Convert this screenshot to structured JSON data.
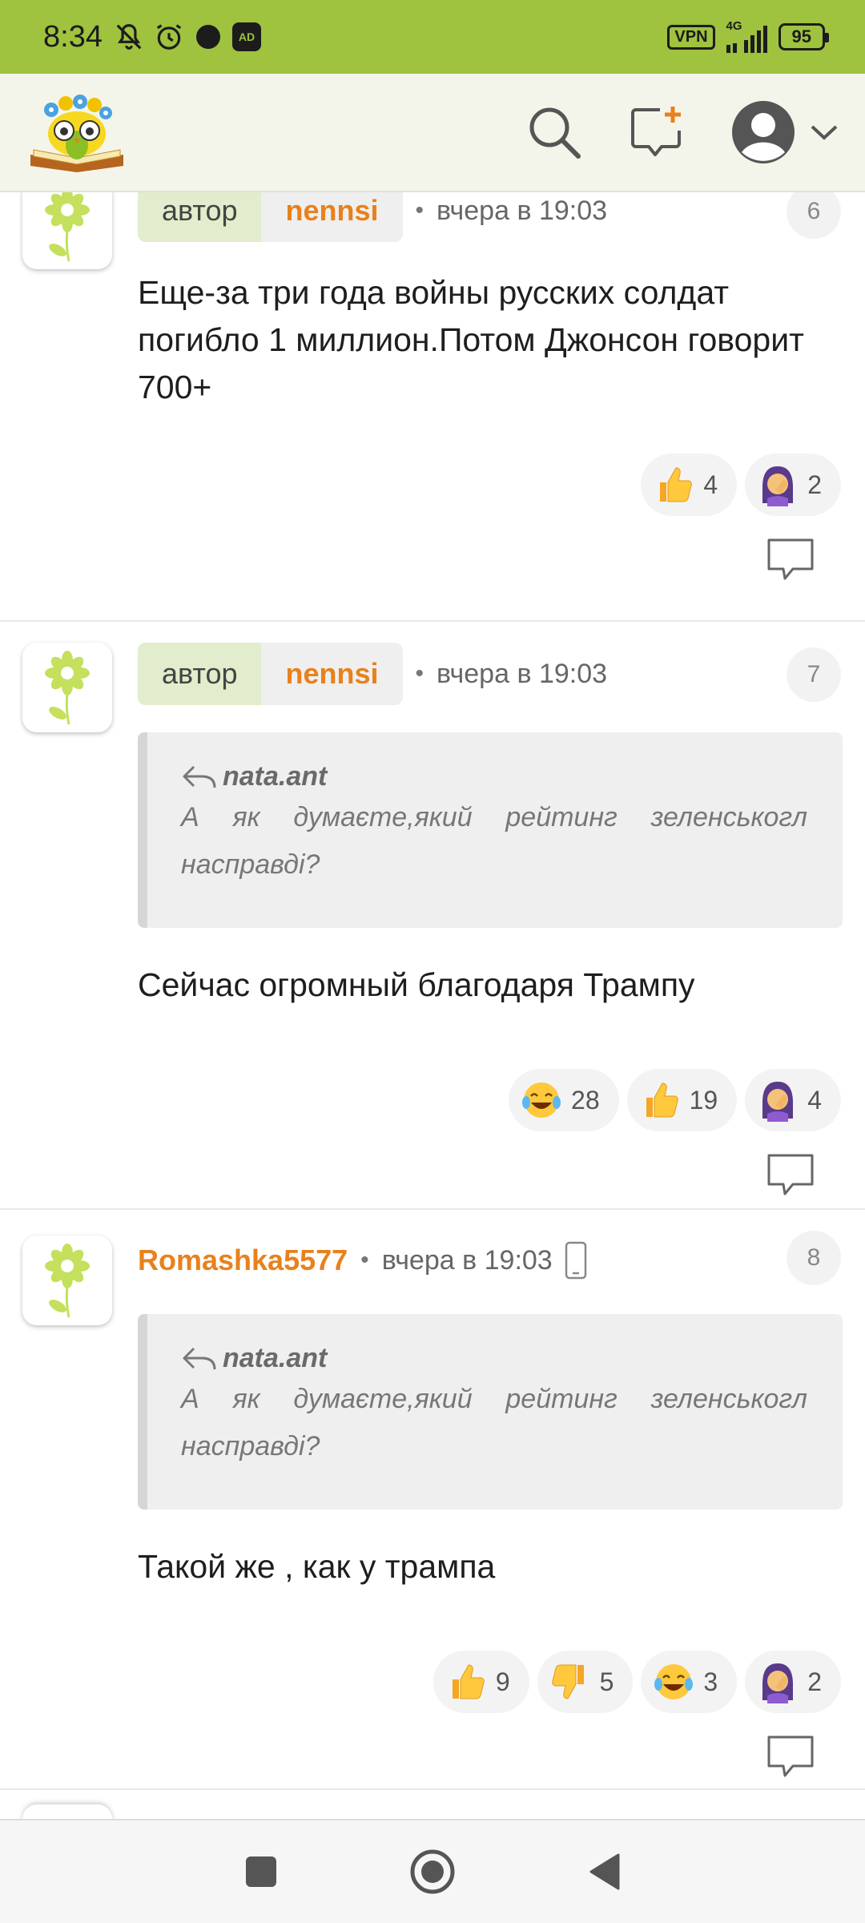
{
  "status_bar": {
    "time": "8:34",
    "vpn": "VPN",
    "network": "4G",
    "battery": "95",
    "adblock": "AD"
  },
  "header": {
    "logo_icon": "book-owl-logo",
    "search_icon": "search-icon",
    "new_post_icon": "new-comment-icon",
    "profile_icon": "avatar-icon"
  },
  "comments": [
    {
      "author_label": "автор",
      "author": "nennsi",
      "time": "вчера в 19:03",
      "number": "6",
      "text": "Еще-за три года войны русских солдат погибло 1 миллион.Потом Джонсон говорит 700+",
      "reactions": [
        {
          "emoji": "thumbs-up",
          "count": "4"
        },
        {
          "emoji": "facepalm",
          "count": "2"
        }
      ]
    },
    {
      "author_label": "автор",
      "author": "nennsi",
      "time": "вчера в 19:03",
      "number": "7",
      "quote_author": "nata.ant",
      "quote_text": "А як думаєте,який рейтинг зеленськогл насправді?",
      "text": "Сейчас огромный благодаря Трампу",
      "reactions": [
        {
          "emoji": "tears-of-joy",
          "count": "28"
        },
        {
          "emoji": "thumbs-up",
          "count": "19"
        },
        {
          "emoji": "facepalm",
          "count": "4"
        }
      ]
    },
    {
      "author": "Romashka5577",
      "time": "вчера в 19:03",
      "number": "8",
      "quote_author": "nata.ant",
      "quote_text": "А як думаєте,який рейтинг зеленськогл насправді?",
      "text": "Такой же , как у трампа",
      "reactions": [
        {
          "emoji": "thumbs-up",
          "count": "9"
        },
        {
          "emoji": "thumbs-down",
          "count": "5"
        },
        {
          "emoji": "tears-of-joy",
          "count": "3"
        },
        {
          "emoji": "facepalm",
          "count": "2"
        }
      ]
    }
  ],
  "colors": {
    "status_bar": "#9fc23f",
    "accent_orange": "#e8811c",
    "author_pill": "#e1edcc"
  }
}
